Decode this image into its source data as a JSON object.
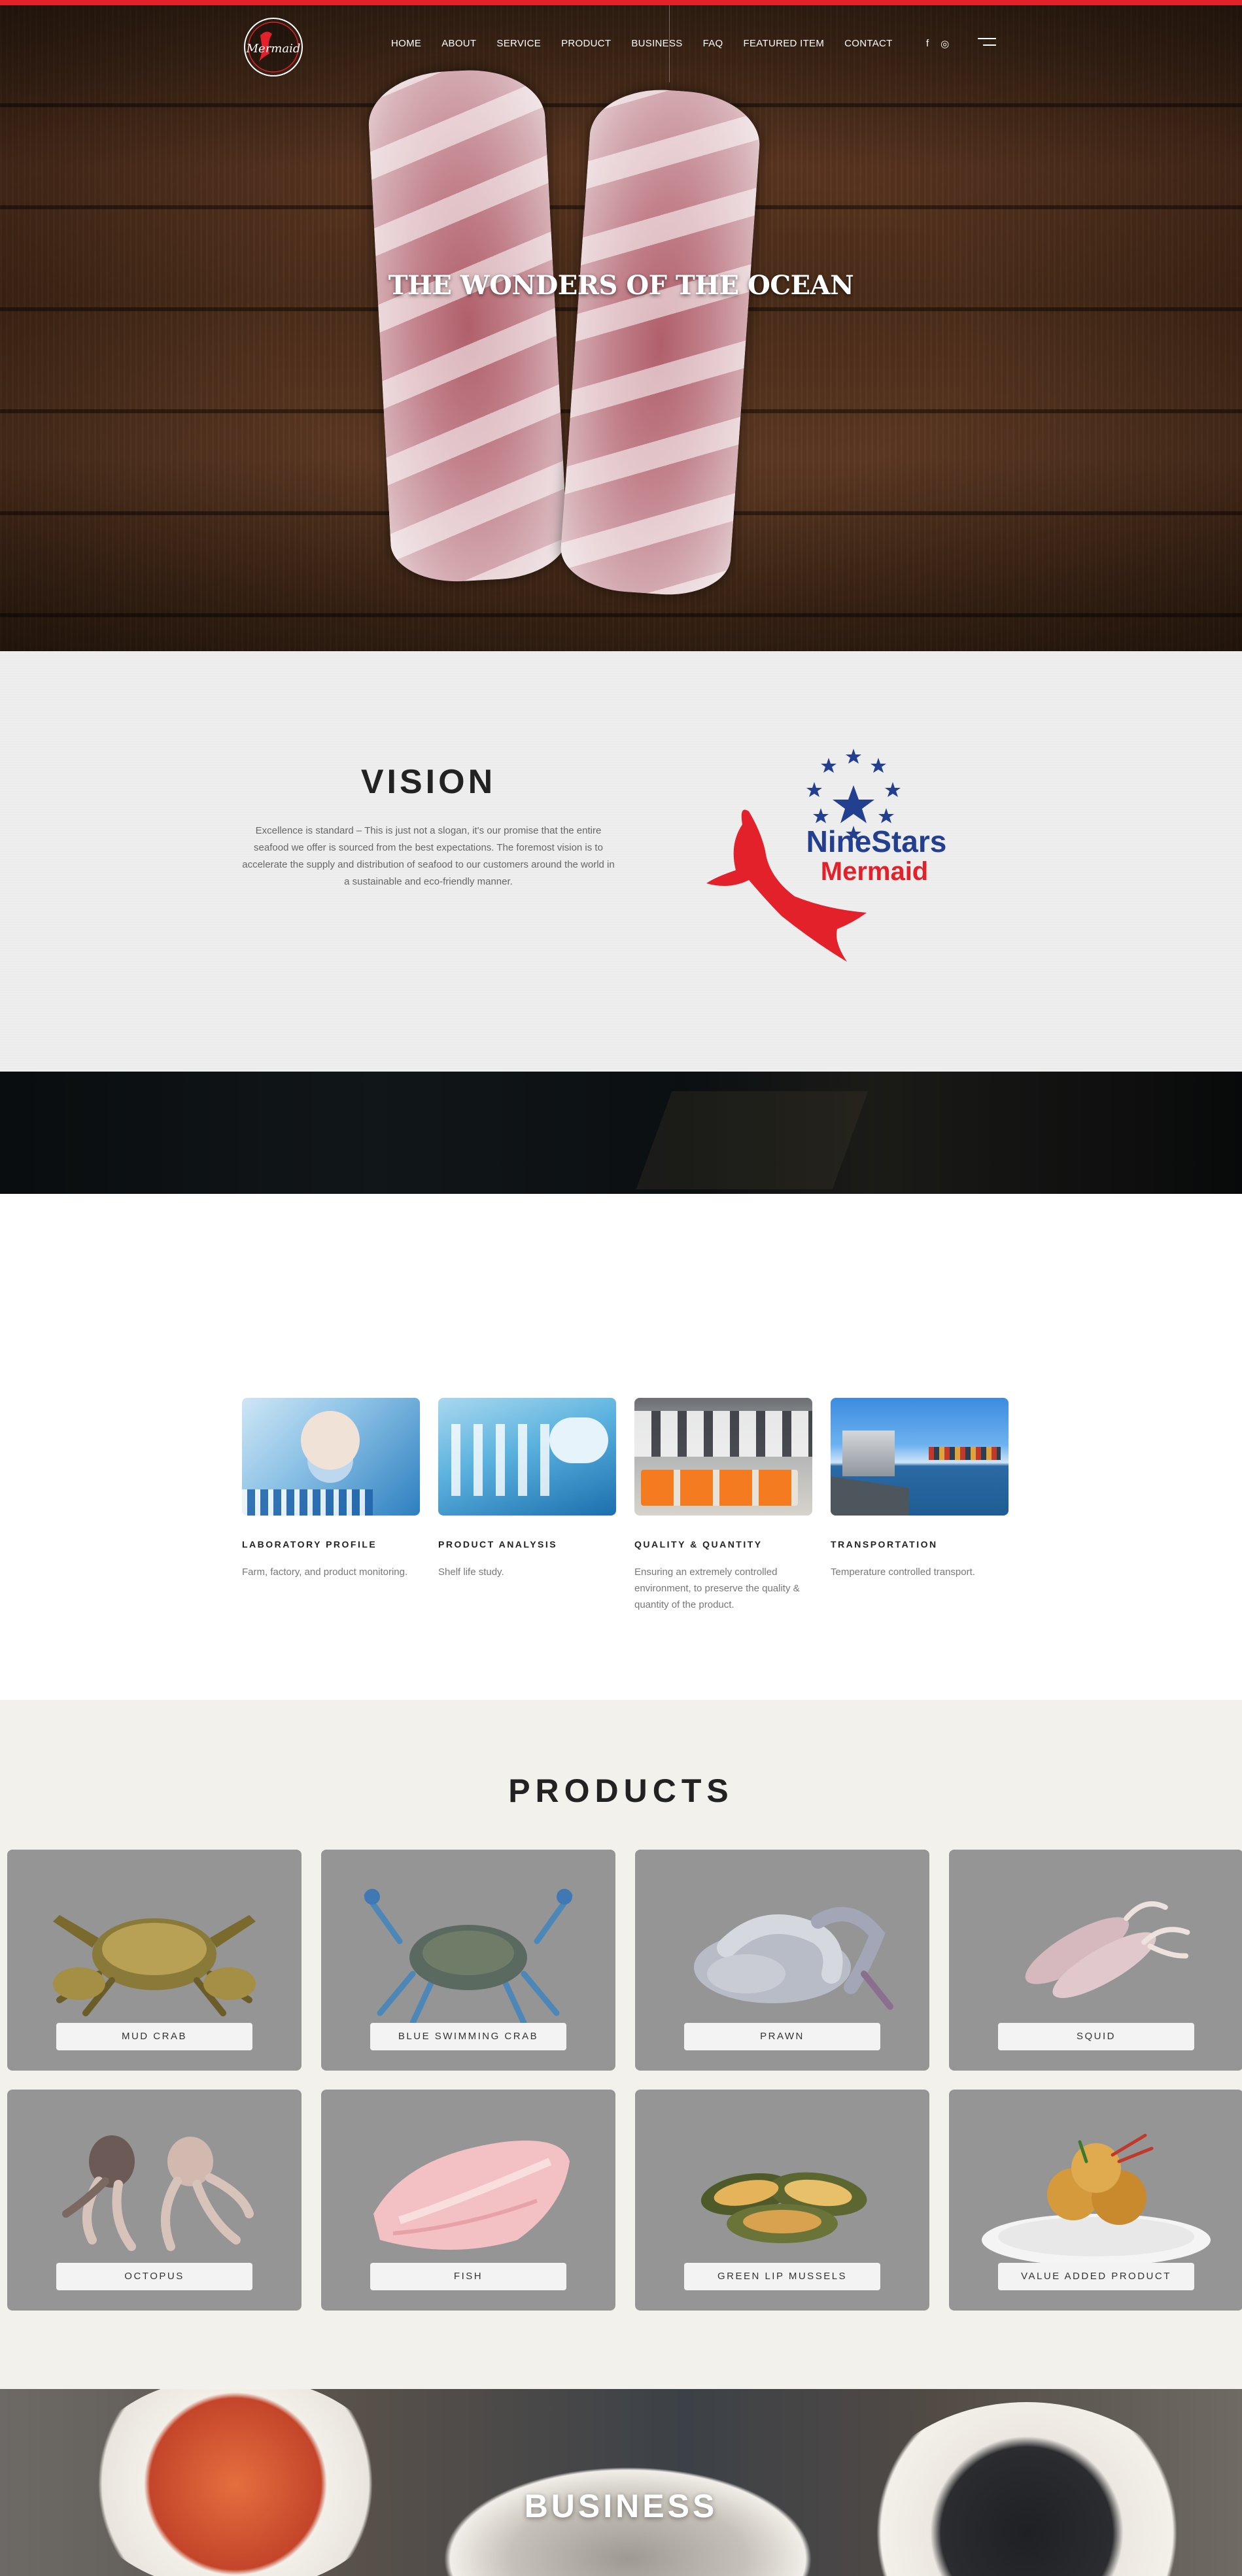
{
  "brand": {
    "logo_text": "Mermaid",
    "logo_stars_text": "NineStars",
    "logo_mermaid_text": "Mermaid",
    "accent_color": "#e2212a",
    "blue_color": "#233f8f"
  },
  "nav": {
    "items": [
      "HOME",
      "ABOUT",
      "SERVICE",
      "PRODUCT",
      "BUSINESS",
      "FAQ",
      "FEATURED ITEM",
      "CONTACT"
    ],
    "social": [
      {
        "icon": "facebook-icon",
        "glyph": "f"
      },
      {
        "icon": "instagram-icon",
        "glyph": "◎"
      }
    ],
    "menu_icon": "hamburger-icon"
  },
  "hero": {
    "title": "THE WONDERS OF THE OCEAN"
  },
  "vision": {
    "title": "VISION",
    "text": "Excellence is standard – This is just not a slogan,  it's our promise that the entire seafood we offer is sourced from the best expectations. The foremost vision is to accelerate the supply and distribution of seafood to our customers around the world in a sustainable and eco-friendly manner."
  },
  "services": {
    "items": [
      {
        "title": "LABORATORY PROFILE",
        "desc": "Farm, factory, and product monitoring."
      },
      {
        "title": "PRODUCT ANALYSIS",
        "desc": "Shelf life study."
      },
      {
        "title": "QUALITY & QUANTITY",
        "desc": "Ensuring an extremely controlled environment, to preserve the quality & quantity of the product."
      },
      {
        "title": "TRANSPORTATION",
        "desc": "Temperature controlled  transport."
      }
    ]
  },
  "products": {
    "title": "PRODUCTS",
    "items": [
      {
        "label": "MUD CRAB",
        "icon": "mud-crab-image"
      },
      {
        "label": "BLUE SWIMMING CRAB",
        "icon": "blue-crab-image"
      },
      {
        "label": "PRAWN",
        "icon": "prawn-image"
      },
      {
        "label": "SQUID",
        "icon": "squid-image"
      },
      {
        "label": "OCTOPUS",
        "icon": "octopus-image"
      },
      {
        "label": "FISH",
        "icon": "fish-fillet-image"
      },
      {
        "label": "GREEN LIP MUSSELS",
        "icon": "mussels-image"
      },
      {
        "label": "VALUE ADDED PRODUCT",
        "icon": "value-added-image"
      }
    ]
  },
  "business": {
    "title": "BUSINESS"
  }
}
